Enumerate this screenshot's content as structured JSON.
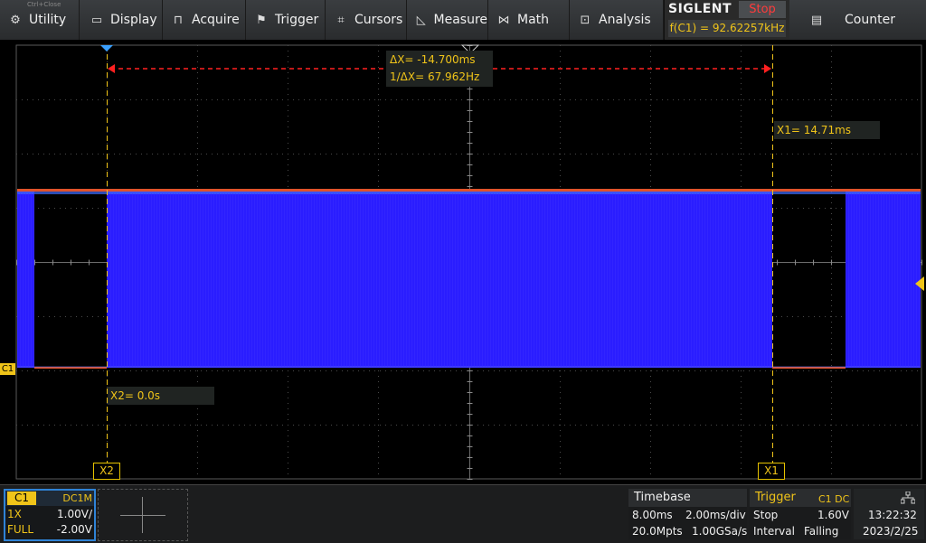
{
  "menu": {
    "items": [
      {
        "label": "Utility",
        "icon": "gear-icon",
        "glyph": "⚙"
      },
      {
        "label": "Display",
        "icon": "monitor-icon",
        "glyph": "▭"
      },
      {
        "label": "Acquire",
        "icon": "acquire-icon",
        "glyph": "⊓"
      },
      {
        "label": "Trigger",
        "icon": "flag-icon",
        "glyph": "⚑"
      },
      {
        "label": "Cursors",
        "icon": "crosshair-icon",
        "glyph": "⌗"
      },
      {
        "label": "Measure",
        "icon": "measure-icon",
        "glyph": "◺"
      },
      {
        "label": "Math",
        "icon": "math-icon",
        "glyph": "⋈"
      },
      {
        "label": "Analysis",
        "icon": "analysis-icon",
        "glyph": "⊡"
      }
    ],
    "counter_label": "Counter",
    "counter_icon": "clipboard-icon",
    "counter_glyph": "▤",
    "tiny_text": "Ctrl+Close"
  },
  "brand": {
    "name": "SIGLENT",
    "run_state": "Stop",
    "frequency": "f(C1) = 92.62257kHz"
  },
  "cursors": {
    "delta_x": "ΔX= -14.700ms",
    "inv_delta_x": "1/ΔX= 67.962Hz",
    "x1_value": "X1= 14.71ms",
    "x2_value": "X2= 0.0s",
    "x1_label": "X1",
    "x2_label": "X2"
  },
  "channel_tag": "C1",
  "channel": {
    "name": "C1",
    "coupling": "DC1M",
    "probe": "1X",
    "scale": "1.00V/",
    "bandwidth": "FULL",
    "offset": "-2.00V",
    "color": "#f0c419"
  },
  "timebase": {
    "title": "Timebase",
    "delay": "8.00ms",
    "scale": "2.00ms/div",
    "memory": "20.0Mpts",
    "sample_rate": "1.00GSa/s"
  },
  "trigger": {
    "title": "Trigger",
    "source": "C1 DC",
    "mode": "Stop",
    "level": "1.60V",
    "type": "Interval",
    "slope": "Falling"
  },
  "clock": {
    "time": "13:22:32",
    "date": "2023/2/25",
    "icon": "network-icon"
  },
  "colors": {
    "trace": "#2a1dff",
    "trace_top": "#e0522a",
    "cursor": "#f0c419",
    "delta_arrow": "#ff2020"
  }
}
